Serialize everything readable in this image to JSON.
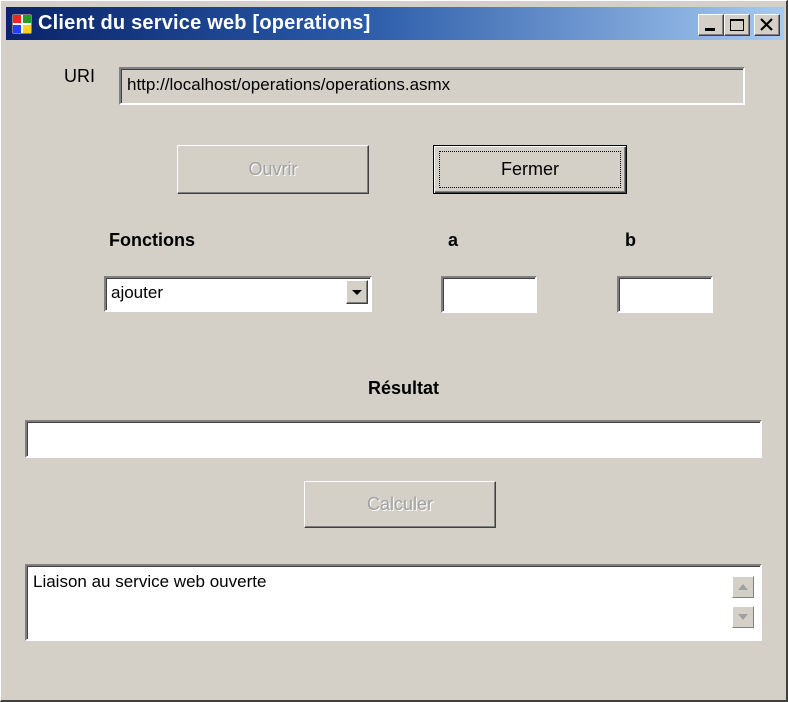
{
  "window": {
    "title": "Client du service web [operations]"
  },
  "uri": {
    "label": "URI",
    "value": "http://localhost/operations/operations.asmx"
  },
  "buttons": {
    "ouvrir": "Ouvrir",
    "fermer": "Fermer",
    "calculer": "Calculer"
  },
  "labels": {
    "fonctions": "Fonctions",
    "a": "a",
    "b": "b",
    "resultat": "Résultat"
  },
  "fonctions_select": {
    "selected": "ajouter"
  },
  "inputs": {
    "a": "",
    "b": "",
    "resultat": ""
  },
  "log": {
    "text": "Liaison au service web ouverte"
  },
  "colors": {
    "title_start": "#0a246a",
    "title_end": "#a6caf0",
    "face": "#d4d0c8"
  }
}
